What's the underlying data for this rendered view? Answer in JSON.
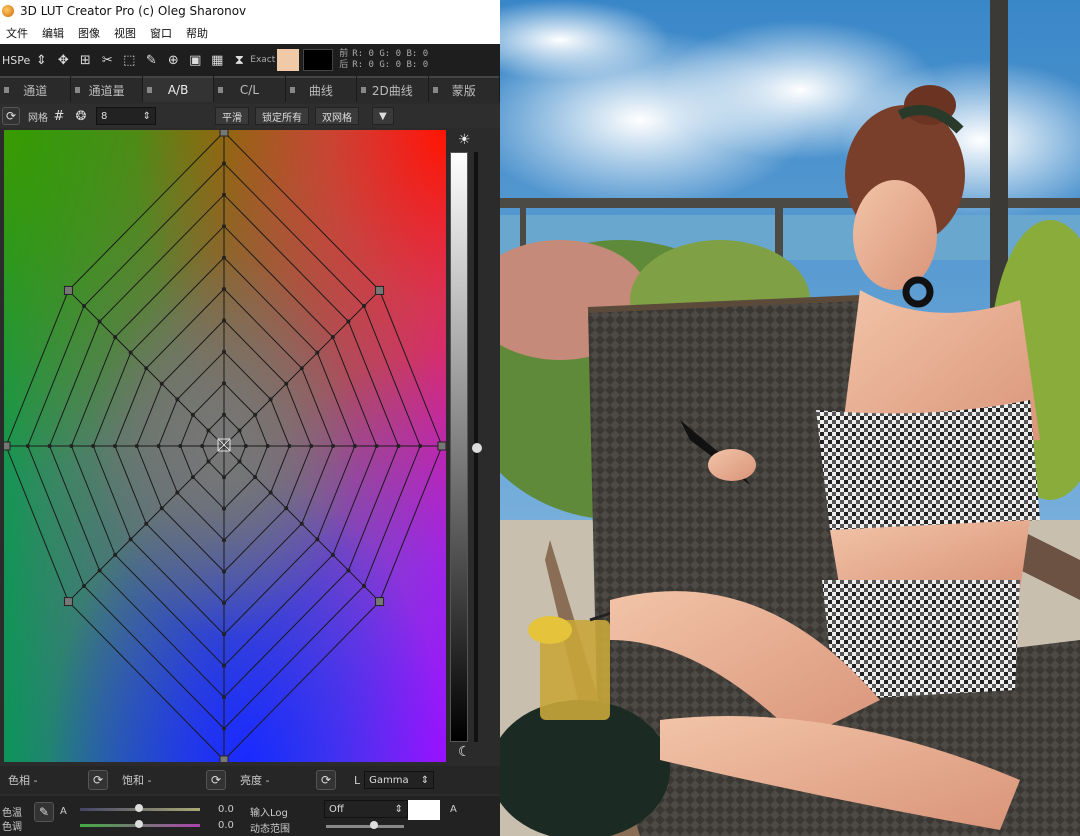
{
  "window": {
    "title": "3D LUT Creator Pro (c) Oleg Sharonov"
  },
  "menu": [
    "文件",
    "编辑",
    "图像",
    "视图",
    "窗口",
    "帮助"
  ],
  "toolbar": {
    "mode": "HSPe",
    "exact_label": "Exact",
    "color_swatch": "#f0c9a8",
    "before_label": "前",
    "after_label": "后",
    "rgb_before": "R: 0  G: 0  B: 0",
    "rgb_after": "R: 0  G: 0  B: 0"
  },
  "tabs": [
    {
      "label": "通道",
      "active": false
    },
    {
      "label": "通道量",
      "active": false
    },
    {
      "label": "A/B",
      "active": true
    },
    {
      "label": "C/L",
      "active": false
    },
    {
      "label": "曲线",
      "active": false
    },
    {
      "label": "2D曲线",
      "active": false
    },
    {
      "label": "蒙版",
      "active": false
    }
  ],
  "subbar": {
    "grid_label": "网格",
    "grid_value": "8",
    "btn_smooth": "平滑",
    "btn_lock_all": "锁定所有",
    "btn_double_grid": "双网格"
  },
  "bottom": {
    "hue_label": "色相 -",
    "saturation_label": "饱和 -",
    "brightness_label": "亮度 -",
    "gamma_label": "L",
    "gamma_value": "Gamma",
    "temp_label": "色温",
    "tint_label": "色调",
    "a_label": "A",
    "temp_value": "0.0",
    "tint_value": "0.0",
    "input_log_label": "输入Log",
    "dynamic_range_label": "动态范围",
    "off_value": "Off",
    "a_label2": "A"
  },
  "colors": {
    "panel_bg": "#2b2b2b",
    "accent_red": "#ff1a00",
    "accent_green": "#3a9a1a",
    "accent_blue": "#1a33ff",
    "accent_magenta": "#d11ad1"
  }
}
